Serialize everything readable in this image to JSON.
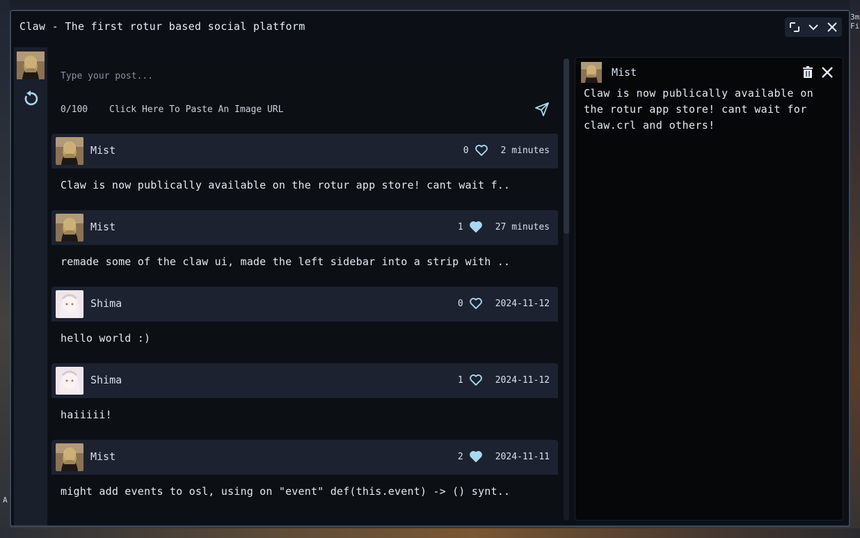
{
  "window": {
    "title": "Claw - The first rotur based social platform"
  },
  "background": {
    "right_edge_text": "3m Fi",
    "left_edge_text": "A"
  },
  "composer": {
    "placeholder": "Type your post...",
    "char_count": "0/100",
    "image_url_label": "Click Here To Paste An Image URL"
  },
  "posts": [
    {
      "author": "Mist",
      "likes": "0",
      "liked": false,
      "time": "2 minutes",
      "text": "Claw is now publically available on the rotur app store! cant wait f..",
      "avatar": "mist"
    },
    {
      "author": "Mist",
      "likes": "1",
      "liked": true,
      "time": "27 minutes",
      "text": "remade some of the claw ui, made the left sidebar into a strip with ..",
      "avatar": "mist"
    },
    {
      "author": "Shima",
      "likes": "0",
      "liked": false,
      "time": "2024-11-12",
      "text": "hello world :)",
      "avatar": "shima"
    },
    {
      "author": "Shima",
      "likes": "1",
      "liked": false,
      "time": "2024-11-12",
      "text": "haiiiii!",
      "avatar": "shima"
    },
    {
      "author": "Mist",
      "likes": "2",
      "liked": true,
      "time": "2024-11-11",
      "text": "might add events to osl, using on \"event\" def(this.event) -> () synt..",
      "avatar": "mist"
    }
  ],
  "detail": {
    "author": "Mist",
    "text": "Claw is now publically available on the rotur app store! cant wait for claw.crl and others!"
  },
  "colors": {
    "accent": "#a8d8ee",
    "window_bg": "#0c1016",
    "post_header_bg": "#1d2230",
    "border": "#3a4a5e"
  }
}
